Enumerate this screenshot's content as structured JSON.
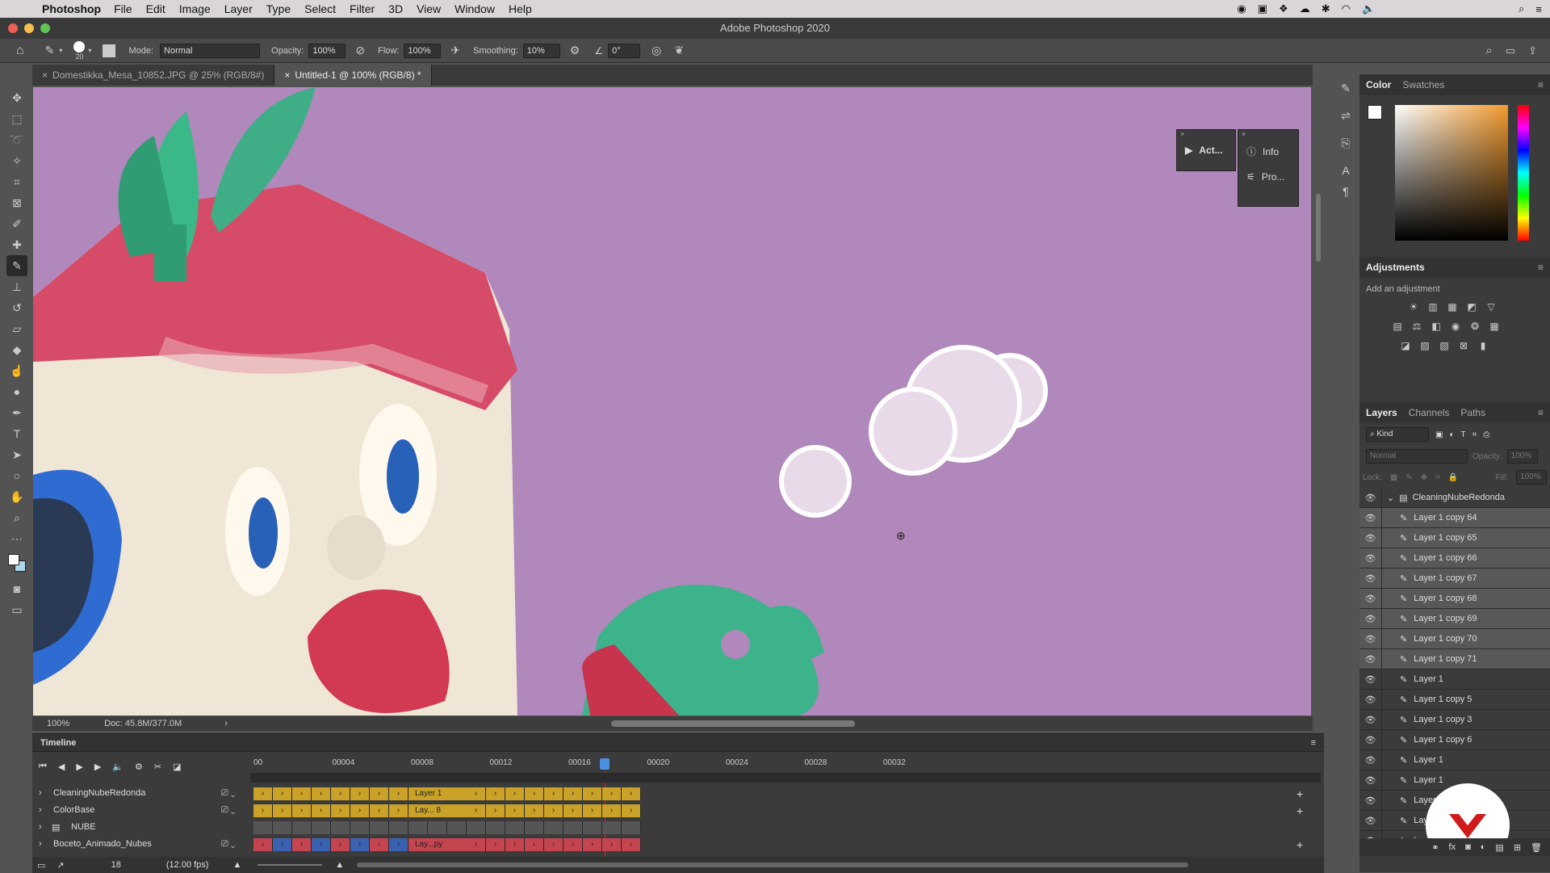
{
  "menubar": {
    "app_name": "Photoshop",
    "items": [
      "File",
      "Edit",
      "Image",
      "Layer",
      "Type",
      "Select",
      "Filter",
      "3D",
      "View",
      "Window",
      "Help"
    ]
  },
  "window": {
    "title": "Adobe Photoshop 2020"
  },
  "options": {
    "brush_size": "20",
    "mode_label": "Mode:",
    "mode_value": "Normal",
    "opacity_label": "Opacity:",
    "opacity_value": "100%",
    "flow_label": "Flow:",
    "flow_value": "100%",
    "smoothing_label": "Smoothing:",
    "smoothing_value": "10%",
    "angle_value": "0°"
  },
  "tabs": [
    {
      "label": "Domestikka_Mesa_10852.JPG @ 25% (RGB/8#)"
    },
    {
      "label": "Untitled-1 @ 100% (RGB/8) *"
    }
  ],
  "status": {
    "zoom": "100%",
    "doc": "Doc: 45.8M/377.0M"
  },
  "float_panels": {
    "actions": "Act...",
    "info": "Info",
    "properties": "Pro..."
  },
  "color_panel": {
    "tabs": [
      "Color",
      "Swatches"
    ]
  },
  "adjustments": {
    "title": "Adjustments",
    "subtitle": "Add an adjustment"
  },
  "layers_panel": {
    "tabs": [
      "Layers",
      "Channels",
      "Paths"
    ],
    "kind_label": "Kind",
    "blend_mode": "Normal",
    "opacity_label": "Opacity:",
    "opacity_value": "100%",
    "lock_label": "Lock:",
    "fill_label": "Fill:",
    "fill_value": "100%",
    "group_name": "CleaningNubeRedonda",
    "layers": [
      {
        "name": "Layer 1 copy 64",
        "selected": true
      },
      {
        "name": "Layer 1 copy 65",
        "selected": true
      },
      {
        "name": "Layer 1 copy 66",
        "selected": true
      },
      {
        "name": "Layer 1 copy 67",
        "selected": true
      },
      {
        "name": "Layer 1 copy 68",
        "selected": true
      },
      {
        "name": "Layer 1 copy 69",
        "selected": true
      },
      {
        "name": "Layer 1 copy 70",
        "selected": true
      },
      {
        "name": "Layer 1 copy 71",
        "selected": true
      },
      {
        "name": "Layer 1",
        "selected": false
      },
      {
        "name": "Layer 1 copy 5",
        "selected": false
      },
      {
        "name": "Layer 1 copy 3",
        "selected": false
      },
      {
        "name": "Layer 1 copy 6",
        "selected": false
      },
      {
        "name": "Layer 1",
        "selected": false
      },
      {
        "name": "Layer 1",
        "selected": false
      },
      {
        "name": "Layer 1",
        "selected": false
      },
      {
        "name": "Layer 1",
        "selected": false
      },
      {
        "name": "Layer 1 copy",
        "selected": false
      }
    ]
  },
  "timeline": {
    "title": "Timeline",
    "ruler": [
      "00",
      "00004",
      "00008",
      "00012",
      "00016",
      "00020",
      "00024",
      "00028",
      "00032"
    ],
    "fps_frame": "18",
    "fps": "(12.00 fps)",
    "tracks": [
      {
        "name": "CleaningNubeRedonda",
        "clip_label": "Layer 1"
      },
      {
        "name": "ColorBase",
        "clip_label": "Lay... 8"
      },
      {
        "name": "NUBE",
        "clip_label": ""
      },
      {
        "name": "Boceto_Animado_Nubes",
        "clip_label": "Lay...py"
      }
    ]
  },
  "colors": {
    "canvas_bg": "#b088bb",
    "track_yellow": "#c9a227",
    "track_red": "#c4444f",
    "track_blue": "#3a62b0",
    "badge_red": "#d11a1a"
  }
}
